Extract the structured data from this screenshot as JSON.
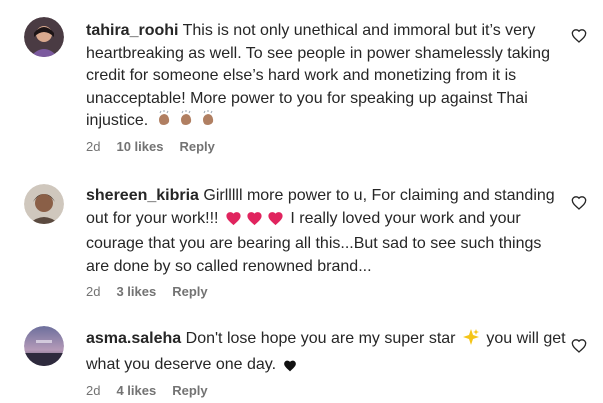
{
  "comments": [
    {
      "username": "tahira_roohi",
      "text": "This is not only unethical and immoral but it’s very heartbreaking as well. To see people in power shamelessly taking credit for someone else’s hard work and monetizing from it is unacceptable! More power to you for speaking up against Thai injustice.",
      "emojis": [
        "clap-icon",
        "clap-icon",
        "clap-icon"
      ],
      "time": "2d",
      "likes": "10 likes",
      "reply": "Reply"
    },
    {
      "username": "shereen_kibria",
      "text_a": "Girlllll more power to u, For claiming and standing out for your work!!!",
      "emojis": [
        "red-heart-icon",
        "red-heart-icon",
        "red-heart-icon"
      ],
      "text_b": "I really loved your work and your courage that you are bearing all this...But sad to see such things are done by so called renowned brand...",
      "time": "2d",
      "likes": "3 likes",
      "reply": "Reply"
    },
    {
      "username": "asma.saleha",
      "text_a": "Don't lose hope you are my super star",
      "emoji_mid": "sparkles-icon",
      "text_b": "you will get what you deserve one day.",
      "emoji_end": "black-heart-icon",
      "time": "2d",
      "likes": "4 likes",
      "reply": "Reply"
    }
  ],
  "colors": {
    "text": "#262626",
    "meta": "#737373",
    "red_heart": "#e0245e",
    "clap": "#b07f62",
    "sparkle": "#f5c518"
  }
}
